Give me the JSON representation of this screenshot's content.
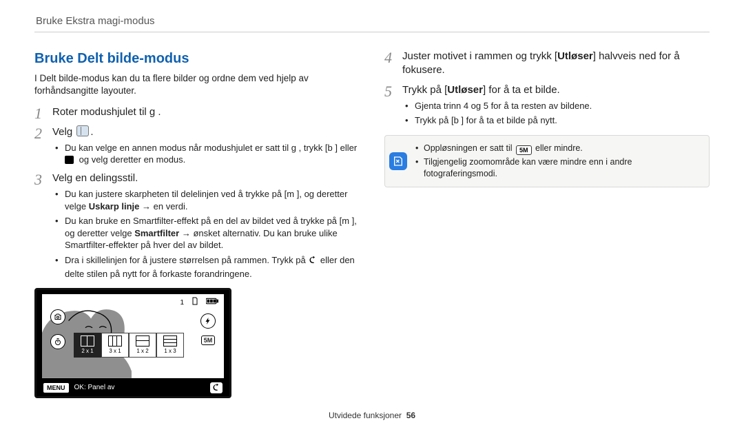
{
  "header": {
    "title": "Bruke Ekstra magi-modus"
  },
  "left": {
    "title": "Bruke Delt bilde-modus",
    "intro": "I Delt bilde-modus kan du ta flere bilder og ordne dem ved hjelp av forhåndsangitte layouter.",
    "step1": "Roter modushjulet til g     .",
    "step2_pre": "Velg ",
    "step2_post": ".",
    "step2_sub_pre": "Du kan velge en annen modus når modushjulet er satt til g     , trykk [b       ] eller ",
    "step2_sub_post": " og velg deretter en modus.",
    "step3": "Velg en delingsstil.",
    "step3_b1_pre": "Du kan justere skarpheten til delelinjen ved å trykke på [m        ], og deretter velge ",
    "step3_b1_bold": "Uskarp linje",
    "step3_b1_post": " → en verdi.",
    "step3_b2_pre": "Du kan bruke en Smartfilter-effekt på en del av bildet ved å trykke på [m        ], og deretter velge ",
    "step3_b2_bold": "Smartfilter",
    "step3_b2_post": " → ønsket alternativ. Du kan bruke ulike Smartfilter-effekter på hver del av bildet.",
    "step3_b3_pre": "Dra i skillelinjen for å justere størrelsen på rammen. Trykk på ",
    "step3_b3_post": " eller den delte stilen på nytt for å forkaste forandringene."
  },
  "right": {
    "step4_pre": "Juster motivet i rammen og trykk [",
    "step4_bold": "Utløser",
    "step4_post": "] halvveis ned for å fokusere.",
    "step5_pre": "Trykk på [",
    "step5_bold": "Utløser",
    "step5_post": "] for å ta et bilde.",
    "step5_b1": "Gjenta trinn 4 og 5 for å ta resten av bildene.",
    "step5_b2": "Trykk på [b       ] for å ta et bilde på nytt.",
    "note1_pre": "Oppløsningen er satt til ",
    "note1_chip": "5M",
    "note1_post": " eller mindre.",
    "note2": "Tilgjengelig zoomområde kan være mindre enn i andre fotograferingsmodi."
  },
  "camera": {
    "status_count": "1",
    "layouts": [
      {
        "label": "2 x 1",
        "active": true,
        "cls": "v"
      },
      {
        "label": "3 x 1",
        "active": false,
        "cls": "v3"
      },
      {
        "label": "1 x 2",
        "active": false,
        "cls": "h"
      },
      {
        "label": "1 x 3",
        "active": false,
        "cls": "h3"
      }
    ],
    "menu_label": "MENU",
    "bottom_text": "OK: Panel av",
    "right_chip": "5M"
  },
  "footer": {
    "text": "Utvidede funksjoner",
    "page": "56"
  }
}
